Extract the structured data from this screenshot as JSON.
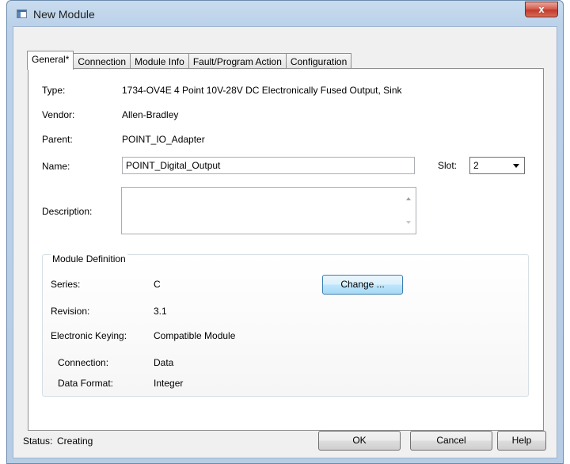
{
  "window": {
    "title": "New Module",
    "close_label": "x"
  },
  "tabs": [
    {
      "label": "General*"
    },
    {
      "label": "Connection"
    },
    {
      "label": "Module Info"
    },
    {
      "label": "Fault/Program Action"
    },
    {
      "label": "Configuration"
    }
  ],
  "general": {
    "type_label": "Type:",
    "type_value": "1734-OV4E 4 Point 10V-28V DC Electronically Fused Output, Sink",
    "vendor_label": "Vendor:",
    "vendor_value": "Allen-Bradley",
    "parent_label": "Parent:",
    "parent_value": "POINT_IO_Adapter",
    "name_label": "Name:",
    "name_value": "POINT_Digital_Output",
    "slot_label": "Slot:",
    "slot_value": "2",
    "description_label": "Description:",
    "description_value": ""
  },
  "module_definition": {
    "title": "Module Definition",
    "series_label": "Series:",
    "series_value": "C",
    "change_label": "Change ...",
    "revision_label": "Revision:",
    "revision_value": "3.1",
    "keying_label": "Electronic Keying:",
    "keying_value": "Compatible Module",
    "connection_label": "Connection:",
    "connection_value": "Data",
    "data_format_label": "Data Format:",
    "data_format_value": "Integer"
  },
  "footer": {
    "status_label": "Status:",
    "status_value": "Creating",
    "ok_label": "OK",
    "cancel_label": "Cancel",
    "help_label": "Help"
  }
}
